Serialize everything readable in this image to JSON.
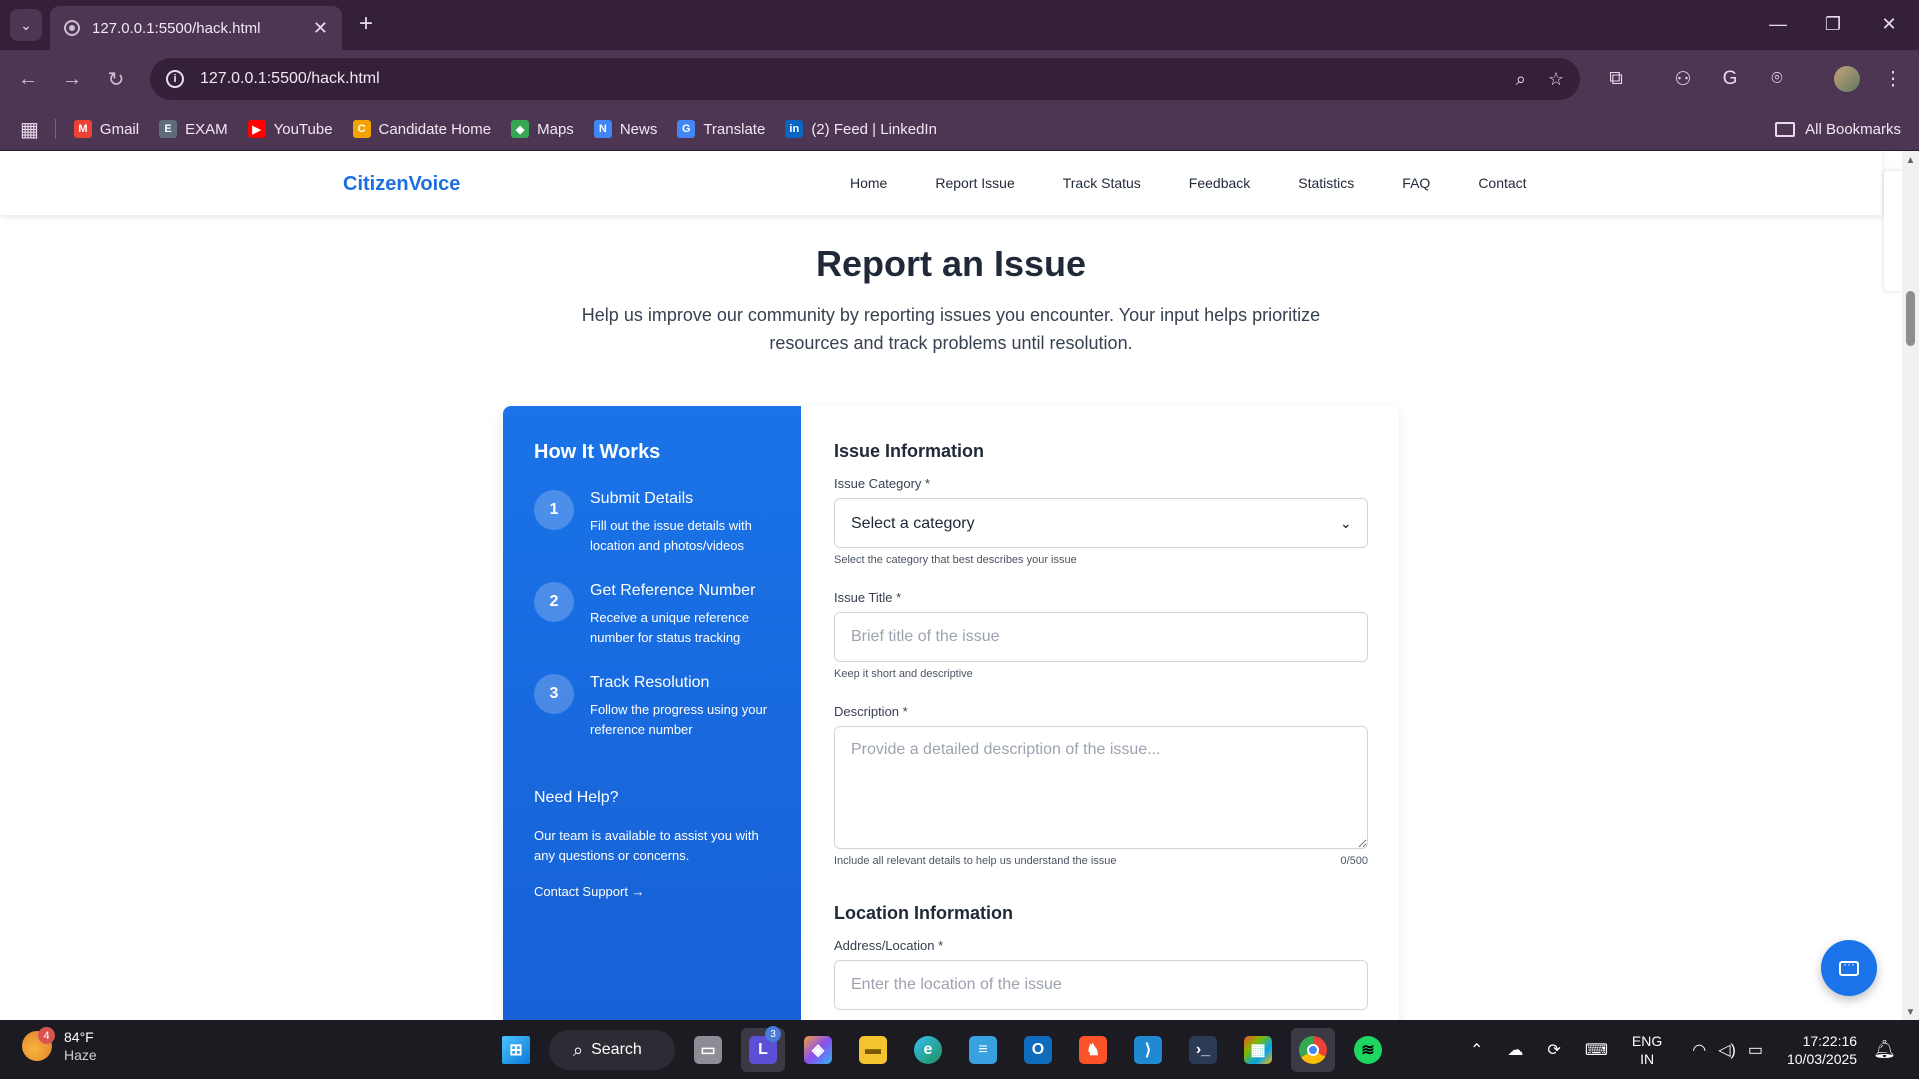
{
  "browser": {
    "tab_title": "127.0.0.1:5500/hack.html",
    "url": "127.0.0.1:5500/hack.html",
    "bookmarks": [
      {
        "label": "Gmail",
        "icon": "gmail-icon",
        "color": "#ea4335"
      },
      {
        "label": "EXAM",
        "icon": "exam-icon",
        "color": "#5f6b7a"
      },
      {
        "label": "YouTube",
        "icon": "youtube-icon",
        "color": "#ff0000"
      },
      {
        "label": "Candidate Home",
        "icon": "candidate-home-icon",
        "color": "#f4a300"
      },
      {
        "label": "Maps",
        "icon": "maps-icon",
        "color": "#34a853"
      },
      {
        "label": "News",
        "icon": "news-icon",
        "color": "#4285f4"
      },
      {
        "label": "Translate",
        "icon": "translate-icon",
        "color": "#4285f4"
      },
      {
        "label": "(2) Feed | LinkedIn",
        "icon": "linkedin-icon",
        "color": "#0a66c2"
      }
    ],
    "all_bookmarks": "All Bookmarks"
  },
  "site": {
    "logo": "CitizenVoice",
    "nav": [
      "Home",
      "Report Issue",
      "Track Status",
      "Feedback",
      "Statistics",
      "FAQ",
      "Contact"
    ]
  },
  "page": {
    "title": "Report an Issue",
    "subtitle": "Help us improve our community by reporting issues you encounter. Your input helps prioritize resources and track problems until resolution."
  },
  "how": {
    "title": "How It Works",
    "steps": [
      {
        "num": "1",
        "title": "Submit Details",
        "desc": "Fill out the issue details with location and photos/videos"
      },
      {
        "num": "2",
        "title": "Get Reference Number",
        "desc": "Receive a unique reference number for status tracking"
      },
      {
        "num": "3",
        "title": "Track Resolution",
        "desc": "Follow the progress using your reference number"
      }
    ],
    "help_title": "Need Help?",
    "help_text": "Our team is available to assist you with any questions or concerns.",
    "help_link": "Contact Support →"
  },
  "form": {
    "issue_section": "Issue Information",
    "category_label": "Issue Category *",
    "category_value": "Select a category",
    "category_hint": "Select the category that best describes your issue",
    "title_label": "Issue Title *",
    "title_placeholder": "Brief title of the issue",
    "title_hint": "Keep it short and descriptive",
    "desc_label": "Description *",
    "desc_placeholder": "Provide a detailed description of the issue...",
    "desc_hint": "Include all relevant details to help us understand the issue",
    "desc_counter": "0/500",
    "location_section": "Location Information",
    "address_label": "Address/Location *",
    "address_placeholder": "Enter the location of the issue"
  },
  "taskbar": {
    "weather_badge": "4",
    "temperature": "84°F",
    "condition": "Haze",
    "search": "Search",
    "lang_top": "ENG",
    "lang_bottom": "IN",
    "time": "17:22:16",
    "date": "10/03/2025",
    "notification_badge": "3"
  }
}
